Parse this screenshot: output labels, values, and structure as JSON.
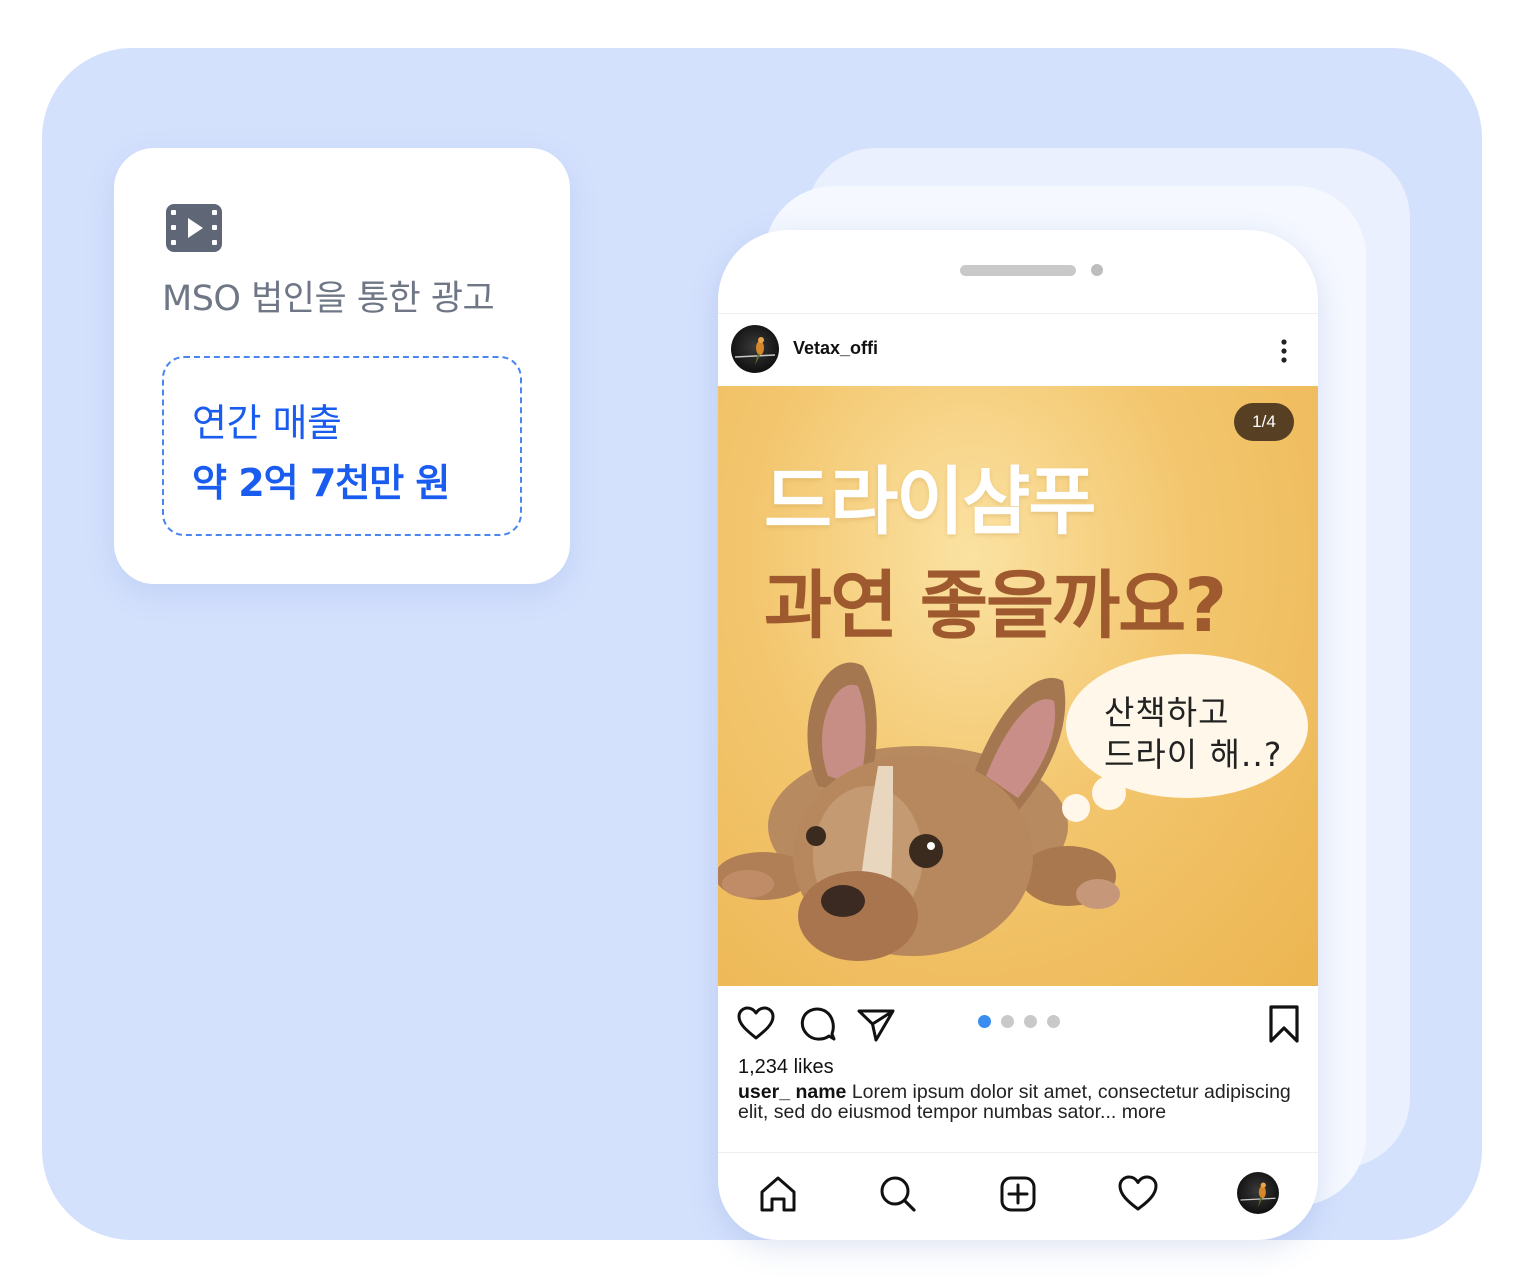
{
  "info_card": {
    "icon": "video-film-icon",
    "label": "MSO 법인을 통한 광고",
    "revenue_line1": "연간 매출",
    "revenue_line2": "약 2억 7천만 원"
  },
  "post": {
    "username": "Vetax_offi",
    "counter": "1/4",
    "headline_line1": "드라이샴푸",
    "headline_line2": "과연 좋을까요?",
    "thought_line1": "산책하고",
    "thought_line2": "드라이 해..?",
    "carousel": {
      "total": 4,
      "active_index": 0
    },
    "likes": "1,234 likes",
    "caption_user": "user_ name",
    "caption_text": " Lorem ipsum dolor sit amet, consectetur adipiscing elit, sed do eiusmod tempor numbas sator... more"
  },
  "icons": {
    "actions": [
      "heart-icon",
      "comment-icon",
      "send-icon",
      "bookmark-icon"
    ],
    "nav": [
      "home-icon",
      "search-icon",
      "add-post-icon",
      "activity-heart-icon",
      "profile-avatar"
    ]
  },
  "colors": {
    "background": "#d4e1fd",
    "accent_blue": "#1a5cf0",
    "headline_brown": "#9e5a2e",
    "post_yellow": "#f3c66e",
    "active_dot": "#3b8cf0"
  }
}
